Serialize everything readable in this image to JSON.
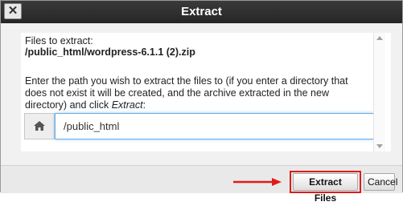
{
  "dialog": {
    "title": "Extract",
    "close_label": "✕"
  },
  "content": {
    "files_label": "Files to extract:",
    "file_path": "/public_html/wordpress-6.1.1 (2).zip",
    "instructions_prefix": "Enter the path you wish to extract the files to (if you enter a directory that does not exist it will be created, and the archive extracted in the new directory) and click ",
    "instructions_emphasis": "Extract",
    "instructions_suffix": ":",
    "path_value": "/public_html",
    "home_icon": "home-icon"
  },
  "footer": {
    "extract_label": "Extract Files",
    "cancel_label": "Cancel",
    "highlight_color": "#e01b1b"
  }
}
